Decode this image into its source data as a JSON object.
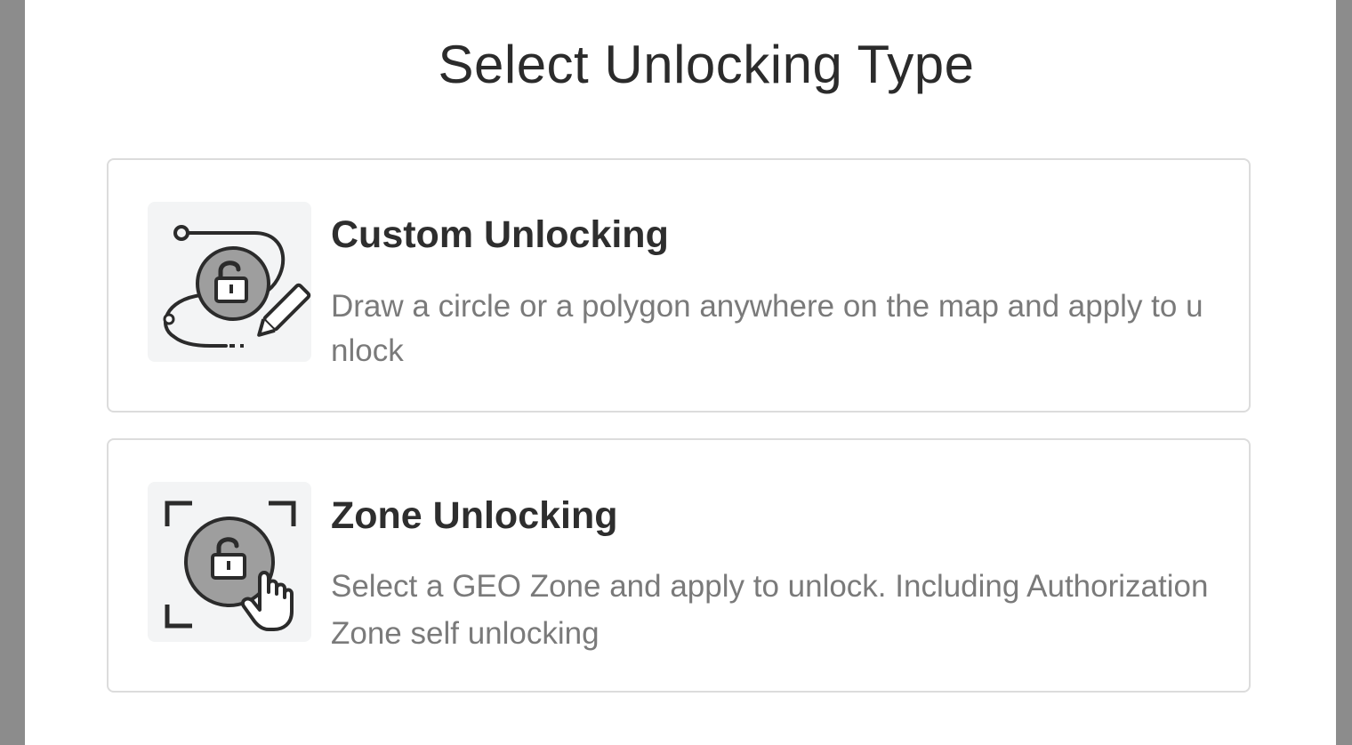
{
  "dialog": {
    "title": "Select Unlocking Type"
  },
  "options": [
    {
      "title": "Custom Unlocking",
      "description": "Draw a circle or a polygon anywhere on the map and apply to unlock",
      "icon": "custom-draw-lock-icon"
    },
    {
      "title": "Zone Unlocking",
      "description": "Select a GEO Zone and apply to unlock. Including Authorization Zone self unlocking",
      "icon": "zone-select-lock-icon"
    }
  ],
  "colors": {
    "backdrop": "#8c8c8c",
    "card_border": "#dcdcdc",
    "icon_bg": "#f3f4f5",
    "icon_fill": "#9e9e9e",
    "title_text": "#2b2b2b",
    "desc_text": "#7a7a7a"
  }
}
